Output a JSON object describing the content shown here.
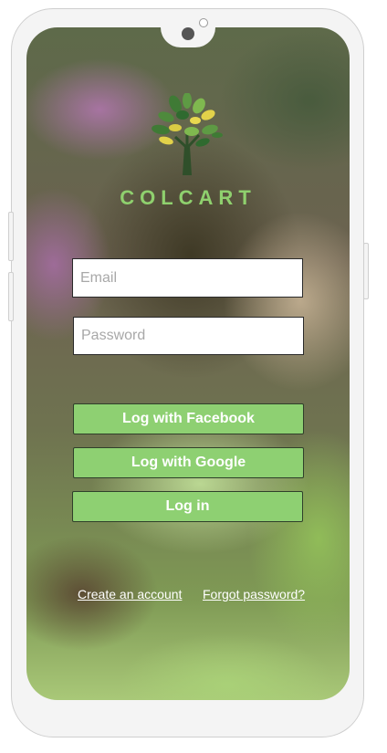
{
  "brand": {
    "name": "COLCART",
    "icon": "tree-logo-icon",
    "color": "#8fd06e"
  },
  "form": {
    "email_placeholder": "Email",
    "email_value": "",
    "password_placeholder": "Password",
    "password_value": ""
  },
  "buttons": {
    "facebook_label": "Log with Facebook",
    "google_label": "Log with Google",
    "login_label": "Log in",
    "color": "#8ed072"
  },
  "links": {
    "create_account": "Create an account",
    "forgot_password": "Forgot password?"
  }
}
